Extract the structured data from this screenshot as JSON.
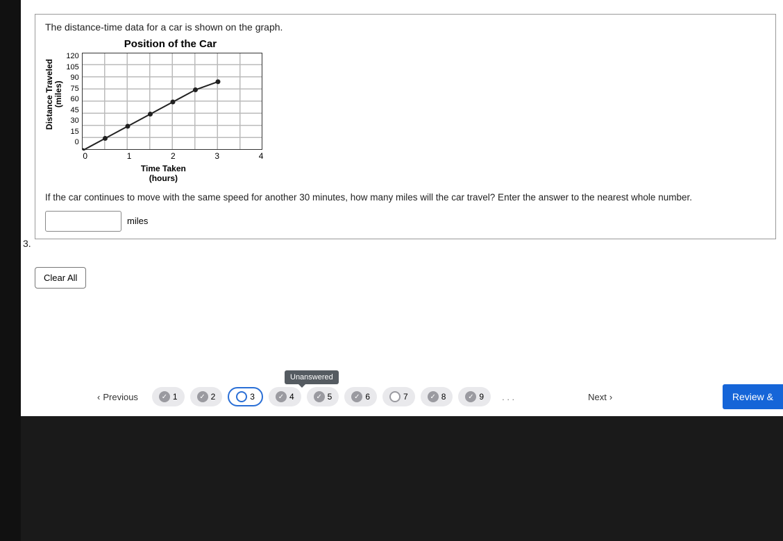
{
  "question_number": "3.",
  "prompt": "The distance-time data for a car is shown on the graph.",
  "question_text": "If the car continues to move with the same speed for another 30 minutes, how many miles will the car travel? Enter the answer to the nearest whole number.",
  "answer_unit": "miles",
  "answer_value": "",
  "clear_all": "Clear All",
  "tooltip": "Unanswered",
  "nav": {
    "previous": "Previous",
    "next": "Next",
    "review": "Review &",
    "dots": ". . ."
  },
  "pills": [
    {
      "n": "1",
      "status": "check"
    },
    {
      "n": "2",
      "status": "check"
    },
    {
      "n": "3",
      "status": "current"
    },
    {
      "n": "4",
      "status": "check"
    },
    {
      "n": "5",
      "status": "check"
    },
    {
      "n": "6",
      "status": "check"
    },
    {
      "n": "7",
      "status": "open"
    },
    {
      "n": "8",
      "status": "check"
    },
    {
      "n": "9",
      "status": "check"
    }
  ],
  "chart_data": {
    "type": "line",
    "title": "Position of the Car",
    "xlabel": "Time Taken\n(hours)",
    "ylabel": "Distance Traveled\n(miles)",
    "x": [
      0,
      0.5,
      1,
      1.5,
      2,
      2.5,
      3
    ],
    "values": [
      0,
      15,
      30,
      45,
      60,
      75,
      85
    ],
    "y_ticks": [
      120,
      105,
      90,
      75,
      60,
      45,
      30,
      15,
      0
    ],
    "x_ticks": [
      0,
      1,
      2,
      3,
      4
    ],
    "xlim": [
      0,
      4
    ],
    "ylim": [
      0,
      120
    ]
  }
}
